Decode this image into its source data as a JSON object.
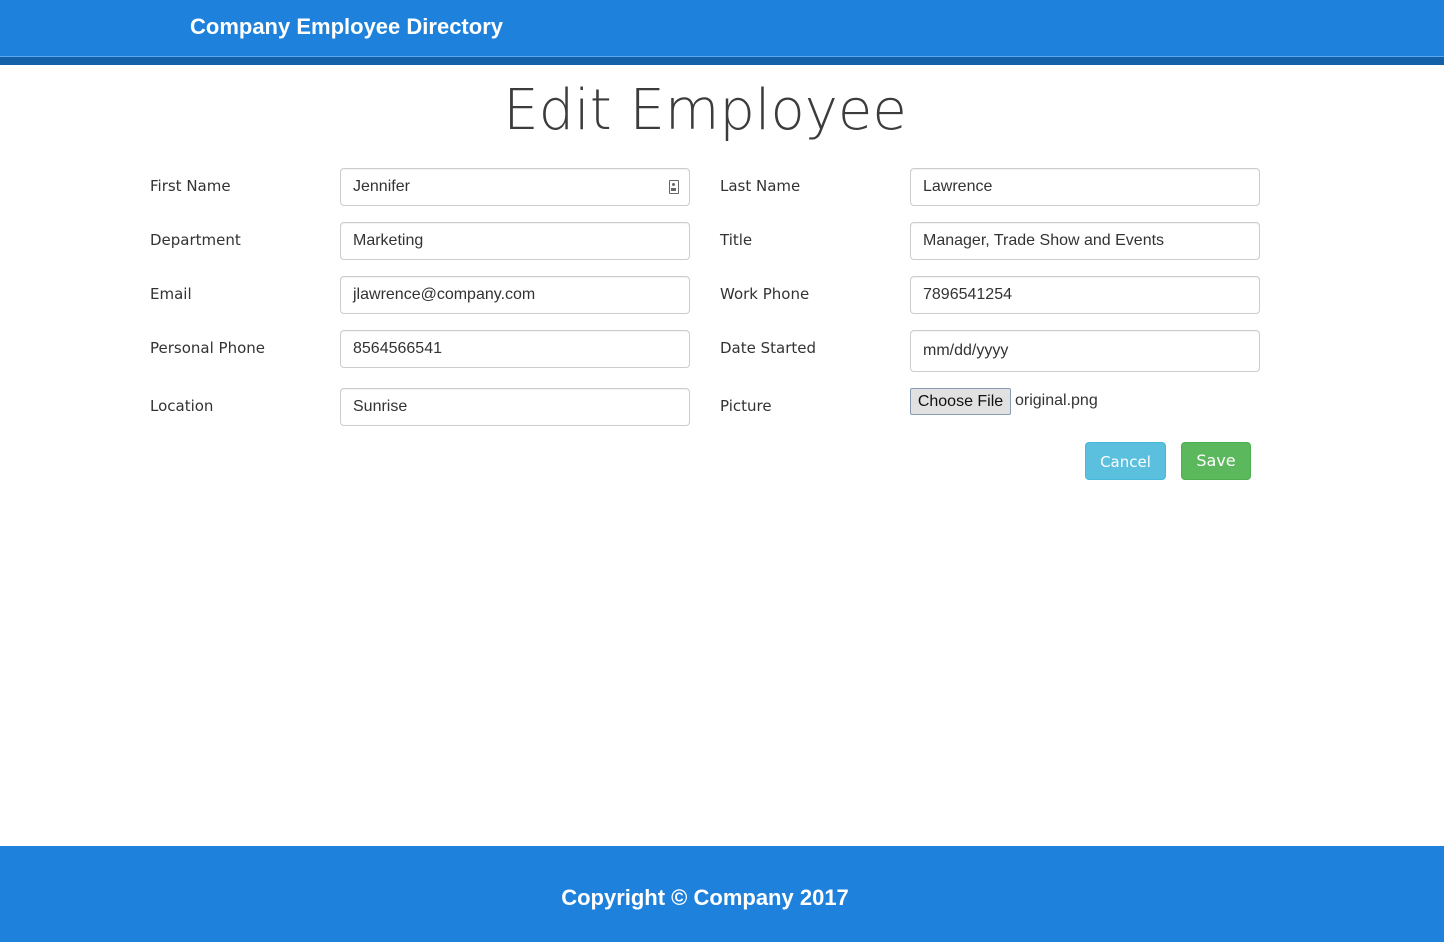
{
  "header": {
    "brand": "Company Employee Directory"
  },
  "page": {
    "title": "Edit Employee"
  },
  "form": {
    "first_name": {
      "label": "First Name",
      "value": "Jennifer"
    },
    "last_name": {
      "label": "Last Name",
      "value": "Lawrence"
    },
    "department": {
      "label": "Department",
      "value": "Marketing"
    },
    "title": {
      "label": "Title",
      "value": "Manager, Trade Show and Events"
    },
    "email": {
      "label": "Email",
      "value": "jlawrence@company.com"
    },
    "work_phone": {
      "label": "Work Phone",
      "value": "7896541254"
    },
    "personal_phone": {
      "label": "Personal Phone",
      "value": "8564566541"
    },
    "date_started": {
      "label": "Date Started",
      "placeholder": "mm/dd/yyyy"
    },
    "location": {
      "label": "Location",
      "value": "Sunrise"
    },
    "picture": {
      "label": "Picture",
      "button_label": "Choose File",
      "file_name": "original.png"
    }
  },
  "actions": {
    "cancel_label": "Cancel",
    "save_label": "Save"
  },
  "footer": {
    "text": "Copyright © Company 2017"
  },
  "icons": {
    "first_name_autofill": "contact-card-icon"
  },
  "colors": {
    "header": "#1e82dc",
    "header_stripe": "#1360a8",
    "cancel": "#5bc0de",
    "save": "#5cb85c"
  }
}
